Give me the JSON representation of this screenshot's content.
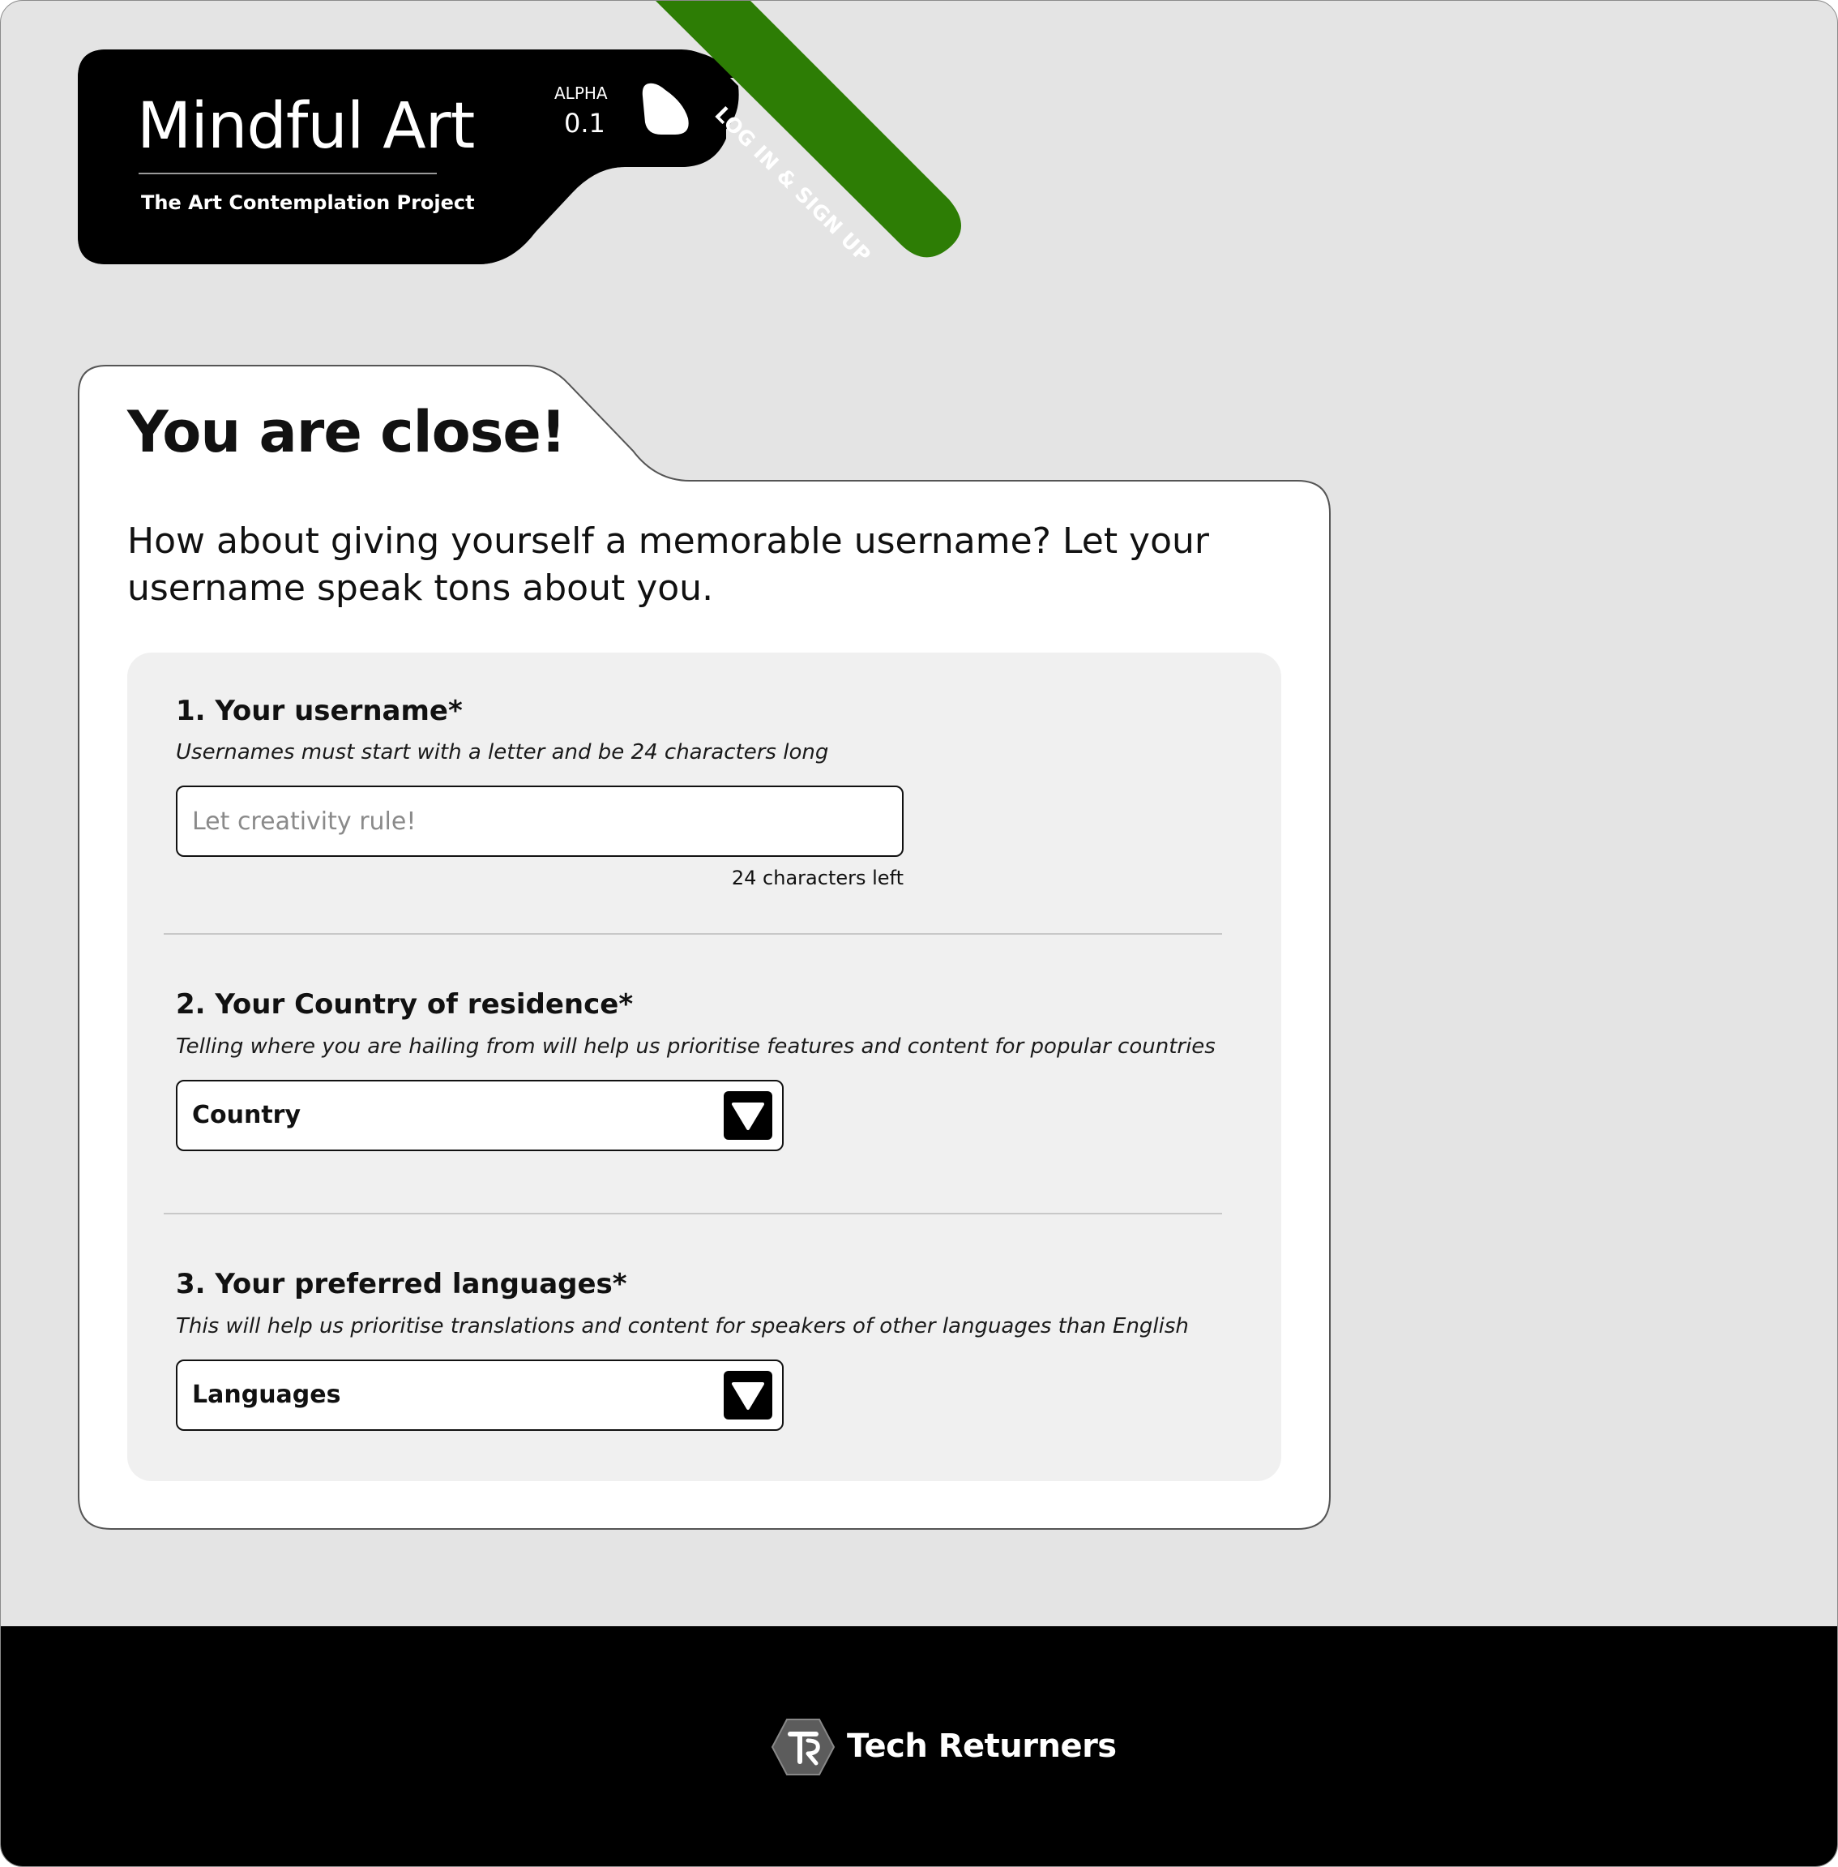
{
  "header": {
    "brand_name": "Mindful Art",
    "tagline": "The Art Contemplation Project",
    "version_label": "ALPHA",
    "version_number": "0.1",
    "ribbon_label": "LOG IN & SIGN UP",
    "colors": {
      "logo_background": "#000000",
      "ribbon": "#2d7d05"
    }
  },
  "card": {
    "title": "You are close!",
    "intro": "How about giving yourself a memorable username? Let your username speak tons about you."
  },
  "form": {
    "username": {
      "title": "1. Your username*",
      "help": "Usernames must start with a letter and be 24 characters long",
      "value": "",
      "placeholder": "Let creativity rule!",
      "counter": "24 characters left"
    },
    "country": {
      "title": "2. Your Country of residence*",
      "help": "Telling where you are hailing from will help us prioritise features and content for popular countries",
      "selected": "Country",
      "icon": "chevron-down-icon"
    },
    "languages": {
      "title": "3. Your preferred languages*",
      "help": "This will help us prioritise translations and content for speakers of other languages than English",
      "selected": "Languages",
      "icon": "chevron-down-icon"
    }
  },
  "footer": {
    "brand_name": "Tech Returners",
    "logo_icon": "tech-returners-logo-icon"
  }
}
